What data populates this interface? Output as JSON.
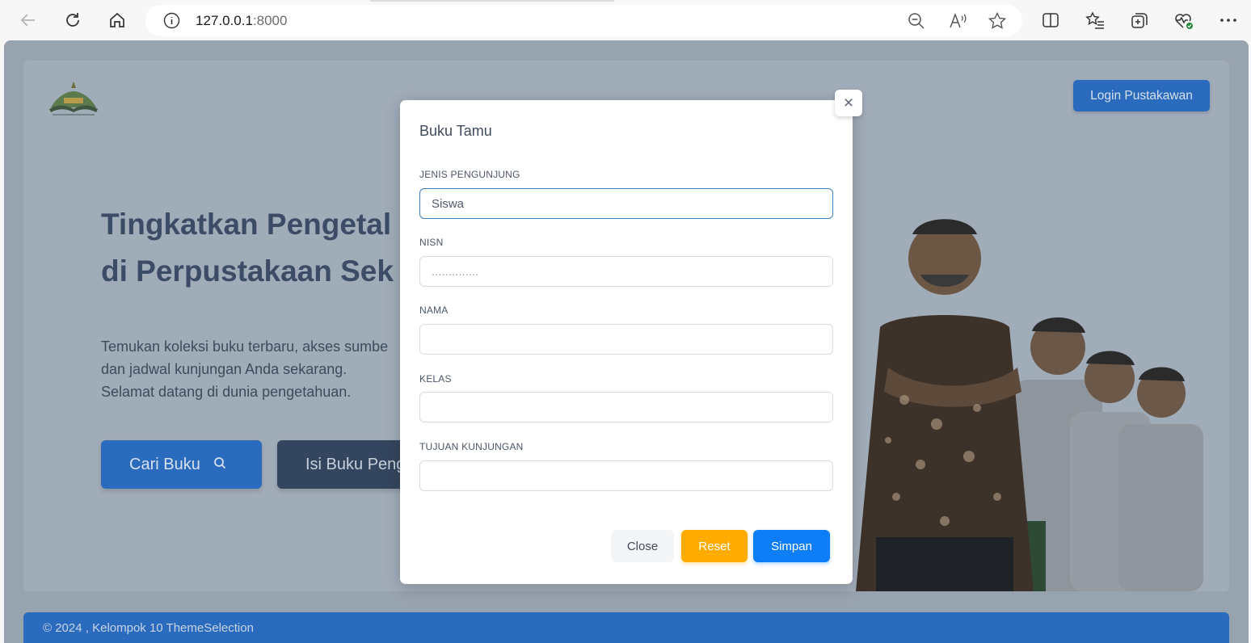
{
  "browser": {
    "url_host": "127.0.0.1",
    "url_port": ":8000"
  },
  "page": {
    "login_label": "Login Pustakawan",
    "hero_title_lines": [
      "Tingkatkan Pengetal",
      "di Perpustakaan Sek"
    ],
    "hero_desc_lines": [
      "Temukan koleksi buku terbaru, akses sumbe",
      "dan jadwal kunjungan Anda sekarang.",
      "Selamat datang di dunia pengetahuan."
    ],
    "btn_cari_label": "Cari Buku",
    "btn_isi_label": "Isi Buku Peng",
    "footer_text": "© 2024 , Kelompok 10 ThemeSelection"
  },
  "modal": {
    "title": "Buku Tamu",
    "close_x": "×",
    "fields": [
      {
        "label": "JENIS PENGUNJUNG",
        "value": "Siswa",
        "placeholder": ""
      },
      {
        "label": "NISN",
        "value": "",
        "placeholder": ".............."
      },
      {
        "label": "NAMA",
        "value": "",
        "placeholder": ""
      },
      {
        "label": "KELAS",
        "value": "",
        "placeholder": ""
      },
      {
        "label": "TUJUAN KUNJUNGAN",
        "value": "",
        "placeholder": ""
      }
    ],
    "buttons": {
      "close": "Close",
      "reset": "Reset",
      "simpan": "Simpan"
    }
  },
  "colors": {
    "primary": "#2a6bbd",
    "reset": "#ffab00",
    "simpan": "#0d7ef8",
    "overlay": "#98a3b0"
  }
}
